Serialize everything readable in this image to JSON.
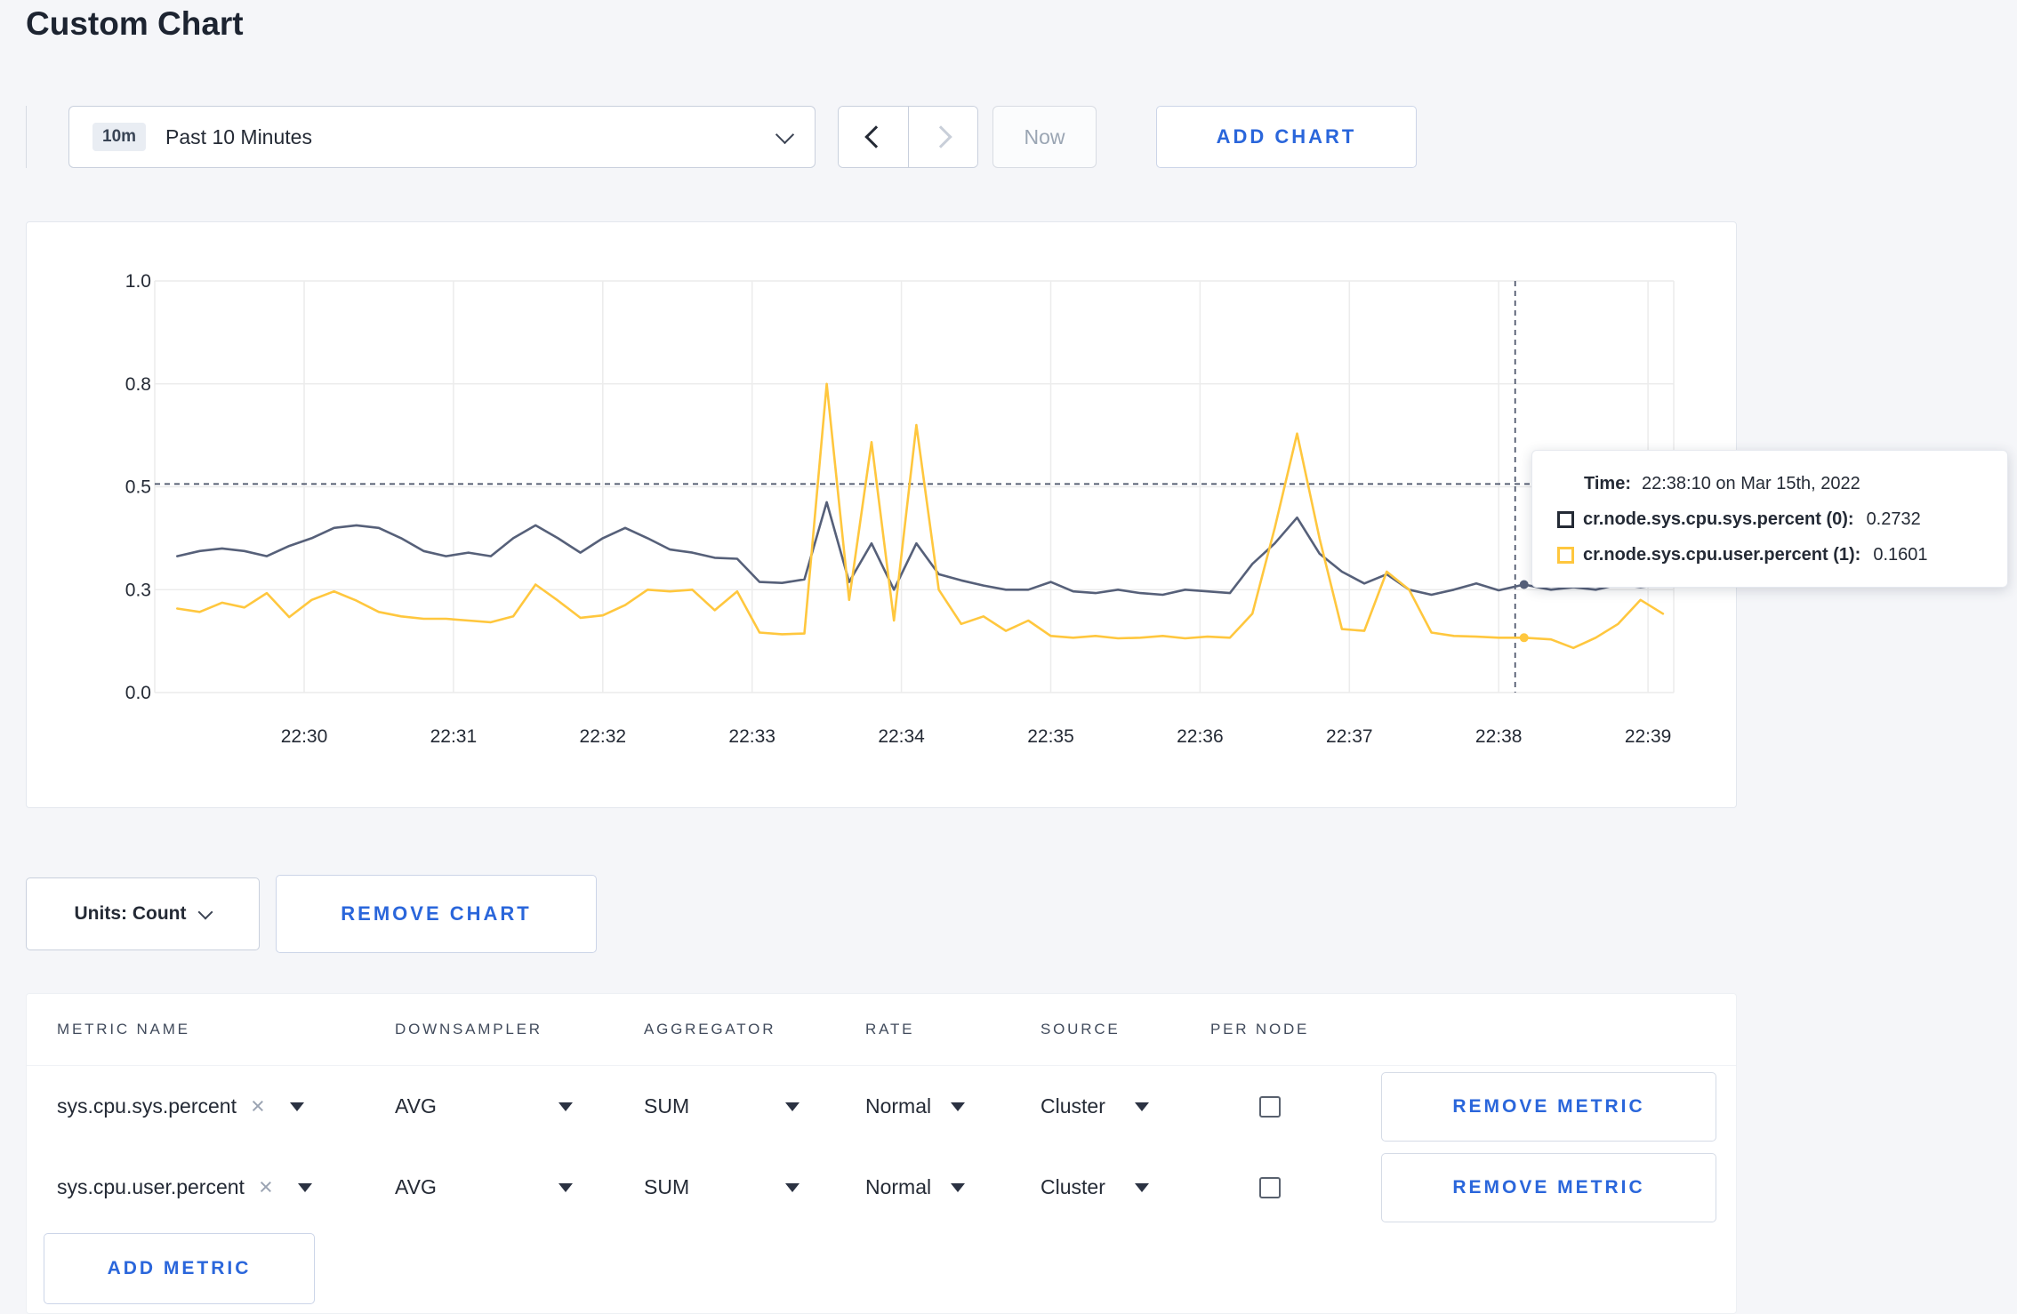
{
  "page": {
    "title": "Custom Chart"
  },
  "icons": {
    "clear": "×"
  },
  "toolbar": {
    "time_range": {
      "badge": "10m",
      "label": "Past 10 Minutes"
    },
    "now_label": "Now",
    "add_chart_label": "ADD CHART"
  },
  "chart_data": {
    "type": "line",
    "title": "",
    "x_axis": {
      "tick_labels": [
        "22:30",
        "22:31",
        "22:32",
        "22:33",
        "22:34",
        "22:35",
        "22:36",
        "22:37",
        "22:38",
        "22:39"
      ],
      "tick_minutes": [
        0,
        1,
        2,
        3,
        4,
        5,
        6,
        7,
        8,
        9
      ]
    },
    "y_axis": {
      "ticks": [
        0,
        0.3,
        0.5,
        0.8,
        1.0
      ],
      "tick_labels": [
        "0.0",
        "0.3",
        "0.5",
        "0.8",
        "1.0"
      ]
    },
    "grid": true,
    "series": [
      {
        "name": "cr.node.sys.cpu.sys.percent",
        "color": "#566079",
        "points": [
          [
            -0.85,
            0.365
          ],
          [
            -0.7,
            0.375
          ],
          [
            -0.55,
            0.38
          ],
          [
            -0.4,
            0.375
          ],
          [
            -0.25,
            0.365
          ],
          [
            -0.1,
            0.385
          ],
          [
            0.05,
            0.4
          ],
          [
            0.2,
            0.42
          ],
          [
            0.35,
            0.425
          ],
          [
            0.5,
            0.42
          ],
          [
            0.65,
            0.4
          ],
          [
            0.8,
            0.375
          ],
          [
            0.95,
            0.365
          ],
          [
            1.1,
            0.372
          ],
          [
            1.25,
            0.365
          ],
          [
            1.4,
            0.4
          ],
          [
            1.55,
            0.425
          ],
          [
            1.7,
            0.4
          ],
          [
            1.85,
            0.372
          ],
          [
            2.0,
            0.4
          ],
          [
            2.15,
            0.42
          ],
          [
            2.3,
            0.4
          ],
          [
            2.45,
            0.378
          ],
          [
            2.6,
            0.372
          ],
          [
            2.75,
            0.362
          ],
          [
            2.9,
            0.36
          ],
          [
            3.05,
            0.315
          ],
          [
            3.2,
            0.313
          ],
          [
            3.35,
            0.32
          ],
          [
            3.5,
            0.47
          ],
          [
            3.65,
            0.315
          ],
          [
            3.8,
            0.39
          ],
          [
            3.95,
            0.3
          ],
          [
            4.1,
            0.39
          ],
          [
            4.25,
            0.33
          ],
          [
            4.4,
            0.318
          ],
          [
            4.55,
            0.308
          ],
          [
            4.7,
            0.3
          ],
          [
            4.85,
            0.3
          ],
          [
            5.0,
            0.315
          ],
          [
            5.15,
            0.295
          ],
          [
            5.3,
            0.29
          ],
          [
            5.45,
            0.3
          ],
          [
            5.6,
            0.29
          ],
          [
            5.75,
            0.285
          ],
          [
            5.9,
            0.3
          ],
          [
            6.05,
            0.295
          ],
          [
            6.2,
            0.29
          ],
          [
            6.35,
            0.35
          ],
          [
            6.5,
            0.39
          ],
          [
            6.65,
            0.44
          ],
          [
            6.8,
            0.37
          ],
          [
            6.95,
            0.335
          ],
          [
            7.1,
            0.312
          ],
          [
            7.25,
            0.33
          ],
          [
            7.4,
            0.3
          ],
          [
            7.55,
            0.285
          ],
          [
            7.7,
            0.3
          ],
          [
            7.85,
            0.312
          ],
          [
            8.0,
            0.298
          ],
          [
            8.17,
            0.31
          ],
          [
            8.35,
            0.3
          ],
          [
            8.5,
            0.305
          ],
          [
            8.65,
            0.3
          ],
          [
            8.8,
            0.31
          ],
          [
            8.95,
            0.305
          ],
          [
            9.1,
            0.31
          ]
        ]
      },
      {
        "name": "cr.node.sys.cpu.user.percent",
        "color": "#ffc73e",
        "points": [
          [
            -0.85,
            0.245
          ],
          [
            -0.7,
            0.235
          ],
          [
            -0.55,
            0.262
          ],
          [
            -0.4,
            0.248
          ],
          [
            -0.25,
            0.29
          ],
          [
            -0.1,
            0.22
          ],
          [
            0.05,
            0.27
          ],
          [
            0.2,
            0.295
          ],
          [
            0.35,
            0.268
          ],
          [
            0.5,
            0.235
          ],
          [
            0.65,
            0.222
          ],
          [
            0.8,
            0.215
          ],
          [
            0.95,
            0.215
          ],
          [
            1.1,
            0.21
          ],
          [
            1.25,
            0.205
          ],
          [
            1.4,
            0.222
          ],
          [
            1.55,
            0.31
          ],
          [
            1.7,
            0.268
          ],
          [
            1.85,
            0.218
          ],
          [
            2.0,
            0.225
          ],
          [
            2.15,
            0.255
          ],
          [
            2.3,
            0.3
          ],
          [
            2.45,
            0.295
          ],
          [
            2.6,
            0.3
          ],
          [
            2.75,
            0.24
          ],
          [
            2.9,
            0.295
          ],
          [
            3.05,
            0.175
          ],
          [
            3.2,
            0.17
          ],
          [
            3.35,
            0.172
          ],
          [
            3.5,
            0.8
          ],
          [
            3.65,
            0.27
          ],
          [
            3.8,
            0.63
          ],
          [
            3.95,
            0.21
          ],
          [
            4.1,
            0.68
          ],
          [
            4.25,
            0.3
          ],
          [
            4.4,
            0.2
          ],
          [
            4.55,
            0.222
          ],
          [
            4.7,
            0.18
          ],
          [
            4.85,
            0.21
          ],
          [
            5.0,
            0.165
          ],
          [
            5.15,
            0.16
          ],
          [
            5.3,
            0.165
          ],
          [
            5.45,
            0.158
          ],
          [
            5.6,
            0.16
          ],
          [
            5.75,
            0.165
          ],
          [
            5.9,
            0.158
          ],
          [
            6.05,
            0.163
          ],
          [
            6.2,
            0.16
          ],
          [
            6.35,
            0.23
          ],
          [
            6.5,
            0.42
          ],
          [
            6.65,
            0.655
          ],
          [
            6.8,
            0.4
          ],
          [
            6.95,
            0.185
          ],
          [
            7.1,
            0.18
          ],
          [
            7.25,
            0.335
          ],
          [
            7.4,
            0.3
          ],
          [
            7.55,
            0.175
          ],
          [
            7.7,
            0.165
          ],
          [
            7.85,
            0.163
          ],
          [
            8.0,
            0.16
          ],
          [
            8.17,
            0.16
          ],
          [
            8.35,
            0.155
          ],
          [
            8.5,
            0.13
          ],
          [
            8.65,
            0.16
          ],
          [
            8.8,
            0.2
          ],
          [
            8.95,
            0.27
          ],
          [
            9.1,
            0.23
          ]
        ]
      }
    ],
    "crosshair": {
      "t_minutes": 8.11,
      "hline_value": 0.508,
      "dots": [
        {
          "series": 0,
          "t": 8.17,
          "value": 0.31
        },
        {
          "series": 1,
          "t": 8.17,
          "value": 0.16
        }
      ]
    }
  },
  "tooltip": {
    "time_label": "Time:",
    "time_value": "22:38:10 on Mar 15th, 2022",
    "rows": [
      {
        "name": "cr.node.sys.cpu.sys.percent (0):",
        "value": "0.2732",
        "color": "#242a35"
      },
      {
        "name": "cr.node.sys.cpu.user.percent (1):",
        "value": "0.1601",
        "color": "#ffc73e"
      }
    ]
  },
  "units": {
    "label": "Units: Count",
    "remove_chart_label": "REMOVE CHART"
  },
  "metrics_table": {
    "headers": [
      "METRIC NAME",
      "DOWNSAMPLER",
      "AGGREGATOR",
      "RATE",
      "SOURCE",
      "PER NODE"
    ],
    "rows": [
      {
        "metric": "sys.cpu.sys.percent",
        "downsampler": "AVG",
        "aggregator": "SUM",
        "rate": "Normal",
        "source": "Cluster",
        "per_node": false,
        "remove_label": "REMOVE METRIC"
      },
      {
        "metric": "sys.cpu.user.percent",
        "downsampler": "AVG",
        "aggregator": "SUM",
        "rate": "Normal",
        "source": "Cluster",
        "per_node": false,
        "remove_label": "REMOVE METRIC"
      }
    ],
    "add_metric_label": "ADD METRIC"
  }
}
